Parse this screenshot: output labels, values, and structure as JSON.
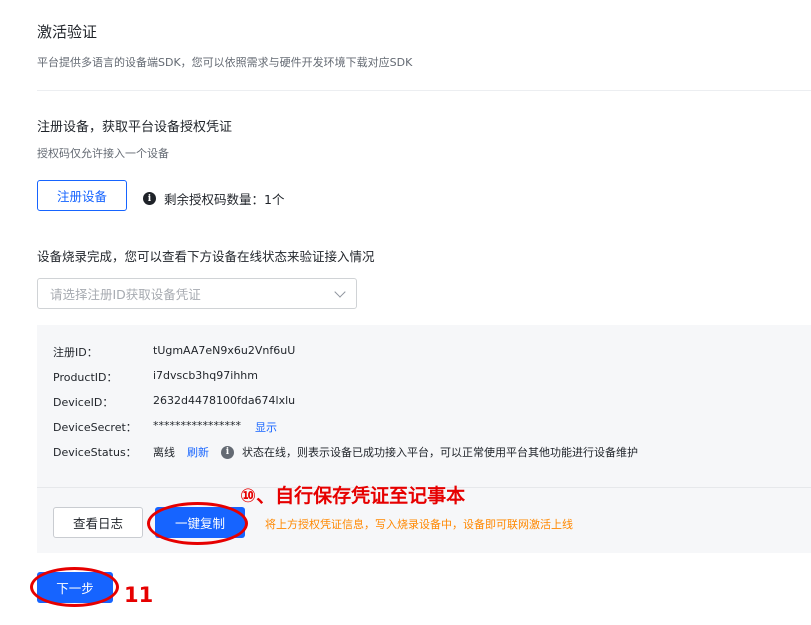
{
  "header": {
    "title": "激活验证",
    "subtitle": "平台提供多语言的设备端SDK，您可以依照需求与硬件开发环境下载对应SDK"
  },
  "register": {
    "heading": "注册设备，获取平台设备授权凭证",
    "note": "授权码仅允许接入一个设备",
    "button_label": "注册设备",
    "info_icon": "i",
    "remaining_label": "剩余授权码数量：1个"
  },
  "verify": {
    "heading": "设备烧录完成，您可以查看下方设备在线状态来验证接入情况",
    "select_placeholder": "请选择注册ID获取设备凭证"
  },
  "credentials": {
    "rows": [
      {
        "label": "注册ID：",
        "value": "tUgmAA7eN9x6u2Vnf6uU"
      },
      {
        "label": "ProductID：",
        "value": "i7dvscb3hq97ihhm"
      },
      {
        "label": "DeviceID：",
        "value": "2632d4478100fda674lxlu"
      },
      {
        "label": "DeviceSecret：",
        "value": "****************",
        "action": "显示"
      },
      {
        "label": "DeviceStatus：",
        "value": "离线",
        "action": "刷新",
        "status_note": "状态在线，则表示设备已成功接入平台，可以正常使用平台其他功能进行设备维护"
      }
    ]
  },
  "actions": {
    "view_log": "查看日志",
    "copy": "一键复制",
    "hint": "将上方授权凭证信息，写入烧录设备中，设备即可联网激活上线",
    "next": "下一步"
  },
  "annotations": {
    "step10": "⑩、自行保存凭证至记事本",
    "step11": "11",
    "color": "#e60000"
  },
  "colors": {
    "primary": "#1664ff",
    "hint": "#ff8800",
    "panel_bg": "#f6f7f9"
  }
}
